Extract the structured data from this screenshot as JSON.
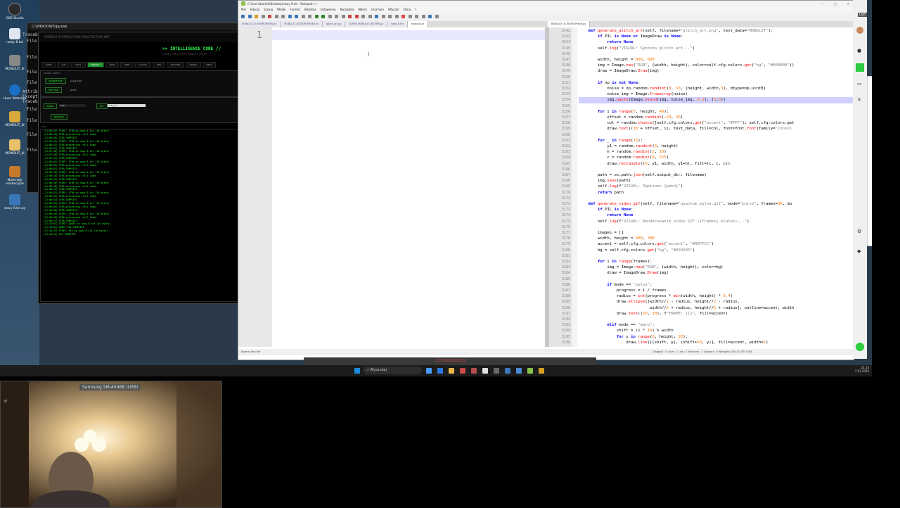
{
  "desktop": {
    "icons": [
      {
        "label": "OBS Studio",
        "color": "#3b3b3b"
      },
      {
        "label": "nowy 8.txt",
        "color": "#dfe6ef"
      },
      {
        "label": "MONOLIT_III",
        "color": "#b4b4b4"
      },
      {
        "label": "Hues Webcam",
        "color": "#1a6fc4"
      },
      {
        "label": "MONOLIT_III",
        "color": "#d6a93a"
      },
      {
        "label": "MONOLIT_III",
        "color": "#e8c06a"
      },
      {
        "label": "Materiały edukacyjne",
        "color": "#c77a2a"
      },
      {
        "label": "nowy 8.txt.py",
        "color": "#3a77b8"
      }
    ]
  },
  "cmd": {
    "title": "C:\\WINDOWS\\py.exe",
    "fragments": [
      "Traceb",
      "File",
      "File",
      "File",
      "File",
      "Attrib",
      "Except",
      "Traceb",
      "File",
      "File",
      "File",
      "File"
    ]
  },
  "core": {
    "header_path": "MONOLIT SYSTEM // PURE ARCHITECTURE.NET",
    "title": ">> INTELLIGENCE CORE //",
    "subtitle": "CORE | LAB | TOOL | REALITY | PATH",
    "tabs": [
      "CORE",
      "LAB",
      "TOOL",
      "REALITY",
      "PATH",
      "WEB",
      "CHAOS",
      "SEQ",
      "PATCHES",
      "BRAIN",
      "HELP"
    ],
    "active_tab": "REALITY",
    "target_label": "TARGET OBJECT",
    "source_file_btn": "SOURCE FILE",
    "source_file_value": "nowy 8.txt",
    "edit_file_btn": "EDIT FILE",
    "edit_file_value": "AUTO",
    "mode_label": "MODE",
    "mode_value": "EXE",
    "key_label": "KEY",
    "key_value": "low_pro",
    "process_btn": "PROCESS",
    "log_label": "LOG:",
    "log": [
      "[21:06:44] START: XTRA on nowy 8.txt (16 bytes)",
      "[21:06:44] XTRA processing (full load)",
      "[21:06:45] XTRA COMPLETE",
      "[21:06:52] START: XTRA on nowy 8.txt (16 bytes)",
      "[21:06:52] XTRA processing (full load)",
      "[21:06:53] XTRA COMPLETE",
      "[21:07:40] START: XTRA on nowy 8.txt (16 bytes)",
      "[21:07:40] XTRA processing (full load)",
      "[21:07:41] XTRA COMPLETE",
      "[21:08:02] START: XTRA on nowy 8.txt (16 bytes)",
      "[21:08:02] XTRA processing (full load)",
      "[21:08:03] XTRA COMPLETE",
      "[21:08:18] START: XTRA on nowy 8.txt (16 bytes)",
      "[21:08:18] XTRA processing (full load)",
      "[21:08:19] XTRA COMPLETE",
      "[21:08:36] START: XTRA on nowy 8.txt (16 bytes)",
      "[21:08:36] XTRA processing (full load)",
      "[21:08:37] XTRA COMPLETE",
      "[21:08:52] START: XTRA on nowy 8.txt (16 bytes)",
      "[21:08:52] XTRA processing (full load)",
      "[21:08:53] XTRA COMPLETE",
      "[21:09:05] START: XTRA on nowy 8.txt (16 bytes)",
      "[21:09:05] XTRA processing (full load)",
      "[21:09:06] XTRA COMPLETE",
      "[21:09:20] START: XTRA on nowy 8.txt (16 bytes)",
      "[21:09:20] XTRA processing (full load)",
      "[21:09:21] XTRA COMPLETE",
      "[21:10:01] START: QUOTE on nowy 8.txt (16 bytes)",
      "[21:10:01] QUOTE ENC COMPLETE",
      "[21:10:22] START: RCX on nowy 8.txt (16 bytes)",
      "[21:10:22] RCX COMPLETE"
    ]
  },
  "npp": {
    "title": "C:\\Users\\bartek\\Desktop\\nowy 8.txt - Notepad++",
    "menu": [
      "Plik",
      "Edycja",
      "Szukaj",
      "Widok",
      "Format",
      "Składnia",
      "Ustawienia",
      "Narzędzia",
      "Makra",
      "Uruchom",
      "Wtyczki",
      "Okna",
      "?"
    ],
    "tabs_left": [
      "MONOLIT_III_ENTROPHIER.py",
      "MONOLIT_III_ENTROPHIER.py",
      "glitch_art.py",
      "SUPER_MONOLIT_HELPER.py",
      "nowy 6.txt",
      "nowy 8.txt"
    ],
    "tabs_right": [
      "MONOLIT_III_ENTROPHIER.py"
    ],
    "left_line": "1",
    "status_left": "Normal text file",
    "status_right": "Długość : 0  Linie : 1     Line : 1  Kolumna : 1  Zaznacz : 0     Windows (CR LF)  UTF-8  INS",
    "code_start": 3142,
    "code": [
      "    def generate_glitch_art(self, filename=\"glitch_art.png\", text_data=\"MONOLIT\"):",
      "        if PIL is None or ImageDraw is None:",
      "            return None",
      "        self.log(\"VISUAL: Synteza glitch art...\")",
      "",
      "        width, height = 800, 600",
      "        img = Image.new(\"RGB\", (width, height), color=self.cfg.colors.get(\"bg\", \"#000000\"))",
      "        draw = ImageDraw.Draw(img)",
      "",
      "        if np is not None:",
      "            noise = np.random.randint(0, 50, (height, width,3), dtype=np.uint8)",
      "            noise_img = Image.fromarray(noise)",
      "            img.paste(Image.blend(img, noise_img, 0.3), (0,0))",
      "",
      "        for i in range(0, height, 40):",
      "            offset = random.randint(-20, 20)",
      "            col = random.choice([self.cfg.colors.get(\"accent\", \"#FFF\"), self.cfg.colors.get",
      "            draw.text((10 + offset, i), text_data, fill=col, font=font.font(family=\"Consol",
      "",
      "        for _ in range(15):",
      "            y1 = random.randint(0, height)",
      "            h = random.randint(2, 10)",
      "            c = random.randint(0, 255)",
      "            draw.rectangle((0, y1, width, y1+h), fill=(c, c, c))",
      "",
      "        path = os.path.join(self.output_dir, filename)",
      "        img.save(path)",
      "        self.log(f\"VISUAL: Zapisano {path}\")",
      "        return path",
      "",
      "    def generate_video_gif(self, filename=\"quantum_pulse.gif\", mode=\"pulse\", frames=30, du",
      "        if PIL is None:",
      "            return None",
      "        self.log(f\"VISUAL: Renderowanie video GIF ({frames} klatek)...\")",
      "",
      "        images = []",
      "        width, height = 400, 300",
      "        accent = self.cfg.colors.get(\"accent\", \"#00FFCC\")",
      "        bg = self.cfg.colors.get(\"bg\", \"#020205\")",
      "",
      "        for i in range(frames):",
      "            img = Image.new(\"RGB\", (width, height), color=bg)",
      "            draw = ImageDraw.Draw(img)",
      "",
      "            if mode == \"pulse\":",
      "                progress = i / frames",
      "                radius = int(progress * min(width, height) * 0.4)",
      "                draw.ellipse([width//2 - radius, height//2 - radius,",
      "                              width//2 + radius, height//2 + radius], outline=accent, width",
      "                draw.text((10, 10), f\"FRAME: {i}\", fill=accent)",
      "",
      "            elif mode == \"warp\":",
      "                shift = (i * 10) % width",
      "                for y in range(0, height, 20):",
      "                    draw.line([(shift, y), (shift+50, y)], fill=accent, width=2)"
    ],
    "highlight_line": 3154
  },
  "taskbar": {
    "search_placeholder": "Wyszukaj",
    "clock_time": "21:14",
    "clock_date": "7.01.2026"
  },
  "webcam": {
    "label": "Samsung SM-A546B (USB)"
  },
  "banner_text": "123 0000000023"
}
